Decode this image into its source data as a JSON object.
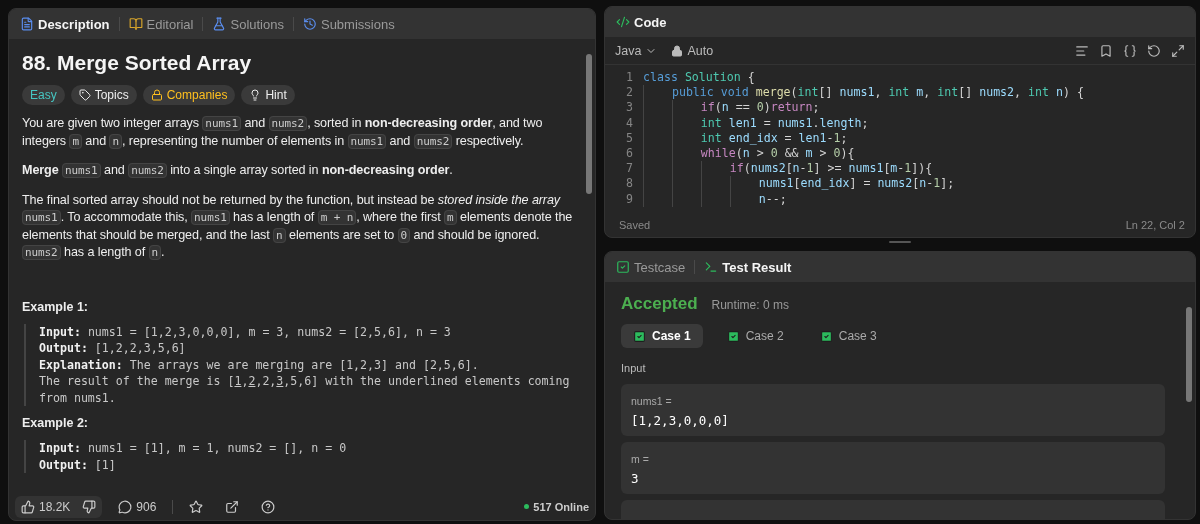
{
  "description_panel": {
    "tabs": [
      {
        "label": "Description",
        "selected": true
      },
      {
        "label": "Editorial",
        "selected": false
      },
      {
        "label": "Solutions",
        "selected": false
      },
      {
        "label": "Submissions",
        "selected": false
      }
    ],
    "title": "88. Merge Sorted Array",
    "tags": [
      {
        "kind": "difficulty",
        "label": "Easy"
      },
      {
        "kind": "topics",
        "label": "Topics"
      },
      {
        "kind": "companies",
        "label": "Companies"
      },
      {
        "kind": "hint",
        "label": "Hint"
      }
    ],
    "paragraphs": [
      [
        {
          "kind": "text",
          "text": "You are given two integer arrays "
        },
        {
          "kind": "code",
          "text": "nums1"
        },
        {
          "kind": "text",
          "text": " and "
        },
        {
          "kind": "code",
          "text": "nums2"
        },
        {
          "kind": "text",
          "text": ", sorted in **non-decreasing order**, and two integers "
        },
        {
          "kind": "code",
          "text": "m"
        },
        {
          "kind": "text",
          "text": " and "
        },
        {
          "kind": "code",
          "text": "n"
        },
        {
          "kind": "text",
          "text": ", representing the number of elements in "
        },
        {
          "kind": "code",
          "text": "nums1"
        },
        {
          "kind": "text",
          "text": " and "
        },
        {
          "kind": "code",
          "text": "nums2"
        },
        {
          "kind": "text",
          "text": " respectively."
        }
      ],
      [
        {
          "kind": "text",
          "text": "**Merge** "
        },
        {
          "kind": "code",
          "text": "nums1"
        },
        {
          "kind": "text",
          "text": " and "
        },
        {
          "kind": "code",
          "text": "nums2"
        },
        {
          "kind": "text",
          "text": " into a single array sorted in **non-decreasing order**."
        }
      ],
      [
        {
          "kind": "text",
          "text": "The final sorted array should not be returned by the function, but instead be *stored inside the array* "
        },
        {
          "kind": "code",
          "text": "nums1"
        },
        {
          "kind": "text",
          "text": ". To accommodate this, "
        },
        {
          "kind": "code",
          "text": "nums1"
        },
        {
          "kind": "text",
          "text": " has a length of "
        },
        {
          "kind": "code",
          "text": "m + n"
        },
        {
          "kind": "text",
          "text": ", where the first "
        },
        {
          "kind": "code",
          "text": "m"
        },
        {
          "kind": "text",
          "text": " elements denote the elements that should be merged, and the last "
        },
        {
          "kind": "code",
          "text": "n"
        },
        {
          "kind": "text",
          "text": " elements are set to "
        },
        {
          "kind": "code",
          "text": "0"
        },
        {
          "kind": "text",
          "text": " and should be ignored. "
        },
        {
          "kind": "code",
          "text": "nums2"
        },
        {
          "kind": "text",
          "text": " has a length of "
        },
        {
          "kind": "code",
          "text": "n"
        },
        {
          "kind": "text",
          "text": "."
        }
      ]
    ],
    "examples": [
      {
        "title": "Example 1:",
        "lines": [
          {
            "label": "Input:",
            "parts": [
              {
                "kind": "text",
                "text": "nums1 = [1,2,3,0,0,0], m = 3, nums2 = [2,5,6], n = 3"
              }
            ]
          },
          {
            "label": "Output:",
            "parts": [
              {
                "kind": "text",
                "text": "[1,2,2,3,5,6]"
              }
            ]
          },
          {
            "label": "Explanation:",
            "parts": [
              {
                "kind": "text",
                "text": "The arrays we are merging are [1,2,3] and [2,5,6]."
              }
            ]
          },
          {
            "parts": [
              {
                "kind": "text",
                "text": "The result of the merge is ["
              },
              {
                "kind": "underline",
                "text": "1"
              },
              {
                "kind": "text",
                "text": ","
              },
              {
                "kind": "underline",
                "text": "2"
              },
              {
                "kind": "text",
                "text": ",2,"
              },
              {
                "kind": "underline",
                "text": "3"
              },
              {
                "kind": "text",
                "text": ",5,6] with the underlined elements coming from nums1."
              }
            ]
          }
        ]
      },
      {
        "title": "Example 2:",
        "lines": [
          {
            "label": "Input:",
            "parts": [
              {
                "kind": "text",
                "text": "nums1 = [1], m = 1, nums2 = [], n = 0"
              }
            ]
          },
          {
            "label": "Output:",
            "parts": [
              {
                "kind": "text",
                "text": "[1]"
              }
            ]
          }
        ]
      }
    ],
    "footer": {
      "likes": "18.2K",
      "comments": "906",
      "online": "517 Online"
    }
  },
  "code_panel": {
    "title": "Code",
    "language": "Java",
    "mode": "Auto",
    "lines": [
      {
        "number": "1",
        "tokens": [
          {
            "kind": "kw",
            "text": "class"
          },
          {
            "kind": "ty",
            "text": " Solution"
          },
          {
            "kind": "p",
            "text": " {"
          }
        ]
      },
      {
        "number": "2",
        "tokens": [
          {
            "kind": "kw",
            "text": "    public"
          },
          {
            "kind": "kw",
            "text": " void"
          },
          {
            "kind": "fn",
            "text": " merge"
          },
          {
            "kind": "p",
            "text": "("
          },
          {
            "kind": "ty",
            "text": "int"
          },
          {
            "kind": "p",
            "text": "[] "
          },
          {
            "kind": "var",
            "text": "nums1"
          },
          {
            "kind": "p",
            "text": ", "
          },
          {
            "kind": "ty",
            "text": "int"
          },
          {
            "kind": "var",
            "text": " m"
          },
          {
            "kind": "p",
            "text": ", "
          },
          {
            "kind": "ty",
            "text": "int"
          },
          {
            "kind": "p",
            "text": "[] "
          },
          {
            "kind": "var",
            "text": "nums2"
          },
          {
            "kind": "p",
            "text": ", "
          },
          {
            "kind": "ty",
            "text": "int"
          },
          {
            "kind": "var",
            "text": " n"
          },
          {
            "kind": "p",
            "text": ") {"
          }
        ]
      },
      {
        "number": "3",
        "tokens": [
          {
            "kind": "ctl",
            "text": "        if"
          },
          {
            "kind": "p",
            "text": "("
          },
          {
            "kind": "var",
            "text": "n"
          },
          {
            "kind": "p",
            "text": " == "
          },
          {
            "kind": "num",
            "text": "0"
          },
          {
            "kind": "p",
            "text": ")"
          },
          {
            "kind": "ctl",
            "text": "return"
          },
          {
            "kind": "p",
            "text": ";"
          }
        ]
      },
      {
        "number": "4",
        "tokens": [
          {
            "kind": "ty",
            "text": "        int"
          },
          {
            "kind": "var",
            "text": " len1"
          },
          {
            "kind": "p",
            "text": " = "
          },
          {
            "kind": "var",
            "text": "nums1"
          },
          {
            "kind": "p",
            "text": "."
          },
          {
            "kind": "var",
            "text": "length"
          },
          {
            "kind": "p",
            "text": ";"
          }
        ]
      },
      {
        "number": "5",
        "tokens": [
          {
            "kind": "ty",
            "text": "        int"
          },
          {
            "kind": "var",
            "text": " end_idx"
          },
          {
            "kind": "p",
            "text": " = "
          },
          {
            "kind": "var",
            "text": "len1"
          },
          {
            "kind": "p",
            "text": "-"
          },
          {
            "kind": "num",
            "text": "1"
          },
          {
            "kind": "p",
            "text": ";"
          }
        ]
      },
      {
        "number": "6",
        "tokens": [
          {
            "kind": "ctl",
            "text": "        while"
          },
          {
            "kind": "p",
            "text": "("
          },
          {
            "kind": "var",
            "text": "n"
          },
          {
            "kind": "p",
            "text": " > "
          },
          {
            "kind": "num",
            "text": "0"
          },
          {
            "kind": "p",
            "text": " && "
          },
          {
            "kind": "var",
            "text": "m"
          },
          {
            "kind": "p",
            "text": " > "
          },
          {
            "kind": "num",
            "text": "0"
          },
          {
            "kind": "p",
            "text": "){"
          }
        ]
      },
      {
        "number": "7",
        "tokens": [
          {
            "kind": "ctl",
            "text": "            if"
          },
          {
            "kind": "p",
            "text": "("
          },
          {
            "kind": "var",
            "text": "nums2"
          },
          {
            "kind": "p",
            "text": "["
          },
          {
            "kind": "var",
            "text": "n"
          },
          {
            "kind": "p",
            "text": "-"
          },
          {
            "kind": "num",
            "text": "1"
          },
          {
            "kind": "p",
            "text": "] >= "
          },
          {
            "kind": "var",
            "text": "nums1"
          },
          {
            "kind": "p",
            "text": "["
          },
          {
            "kind": "var",
            "text": "m"
          },
          {
            "kind": "p",
            "text": "-"
          },
          {
            "kind": "num",
            "text": "1"
          },
          {
            "kind": "p",
            "text": "]){"
          }
        ]
      },
      {
        "number": "8",
        "tokens": [
          {
            "kind": "var",
            "text": "                nums1"
          },
          {
            "kind": "p",
            "text": "["
          },
          {
            "kind": "var",
            "text": "end_idx"
          },
          {
            "kind": "p",
            "text": "] = "
          },
          {
            "kind": "var",
            "text": "nums2"
          },
          {
            "kind": "p",
            "text": "["
          },
          {
            "kind": "var",
            "text": "n"
          },
          {
            "kind": "p",
            "text": "-"
          },
          {
            "kind": "num",
            "text": "1"
          },
          {
            "kind": "p",
            "text": "];"
          }
        ]
      },
      {
        "number": "9",
        "tokens": [
          {
            "kind": "var",
            "text": "                n"
          },
          {
            "kind": "p",
            "text": "--;"
          }
        ]
      }
    ],
    "status": "Saved",
    "cursor": "Ln 22, Col 2"
  },
  "result_panel": {
    "tabs": [
      {
        "kind": "testcase",
        "label": "Testcase",
        "selected": false
      },
      {
        "kind": "result",
        "label": "Test Result",
        "selected": true
      }
    ],
    "verdict": "Accepted",
    "runtime": "Runtime: 0 ms",
    "cases": [
      {
        "label": "Case 1",
        "selected": true
      },
      {
        "label": "Case 2",
        "selected": false
      },
      {
        "label": "Case 3",
        "selected": false
      }
    ],
    "input_label": "Input",
    "inputs": [
      {
        "kind": "variable",
        "name": "nums1 =",
        "value": "[1,2,3,0,0,0]"
      },
      {
        "kind": "variable",
        "name": "m =",
        "value": "3"
      },
      {
        "kind": "cut_off"
      }
    ]
  }
}
